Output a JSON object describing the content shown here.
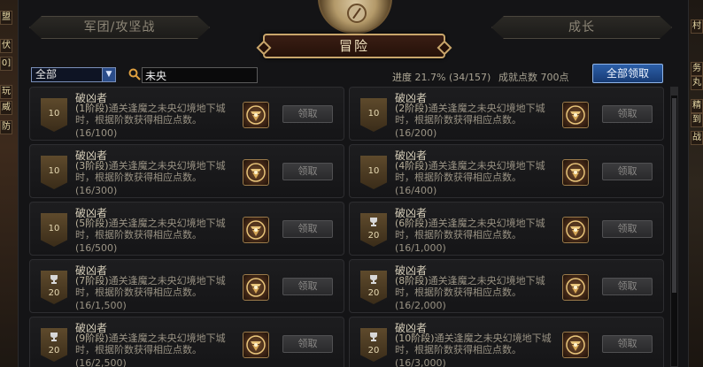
{
  "tabs": {
    "left": "军团/攻坚战",
    "main": "冒险",
    "right": "成长"
  },
  "filter": {
    "selected": "全部"
  },
  "search": {
    "value": "未央"
  },
  "progress": {
    "label": "进度",
    "percent": "21.7%",
    "fraction": "(34/157)"
  },
  "points": {
    "label": "成就点数",
    "value": "700点"
  },
  "claim_all": "全部领取",
  "left_edge_tags": [
    "盟",
    "伏妖",
    "0]",
    "玩",
    "威",
    "防守"
  ],
  "right_edge_tags": [
    "村",
    "务",
    "丸",
    "精",
    "到",
    "战"
  ],
  "achievements": [
    {
      "title": "破凶者",
      "stage": "(1阶段)",
      "desc": "通关逢魔之未央幻境地下城时，根据阶数获得相应点数。",
      "count": "(16/100)",
      "points": "10",
      "trophy": false,
      "claim": "领取"
    },
    {
      "title": "破凶者",
      "stage": "(2阶段)",
      "desc": "通关逢魔之未央幻境地下城时，根据阶数获得相应点数。",
      "count": "(16/200)",
      "points": "10",
      "trophy": false,
      "claim": "领取"
    },
    {
      "title": "破凶者",
      "stage": "(3阶段)",
      "desc": "通关逢魔之未央幻境地下城时，根据阶数获得相应点数。",
      "count": "(16/300)",
      "points": "10",
      "trophy": false,
      "claim": "领取"
    },
    {
      "title": "破凶者",
      "stage": "(4阶段)",
      "desc": "通关逢魔之未央幻境地下城时，根据阶数获得相应点数。",
      "count": "(16/400)",
      "points": "10",
      "trophy": false,
      "claim": "领取"
    },
    {
      "title": "破凶者",
      "stage": "(5阶段)",
      "desc": "通关逢魔之未央幻境地下城时，根据阶数获得相应点数。",
      "count": "(16/500)",
      "points": "10",
      "trophy": false,
      "claim": "领取"
    },
    {
      "title": "破凶者",
      "stage": "(6阶段)",
      "desc": "通关逢魔之未央幻境地下城时，根据阶数获得相应点数。",
      "count": "(16/1,000)",
      "points": "20",
      "trophy": true,
      "claim": "领取"
    },
    {
      "title": "破凶者",
      "stage": "(7阶段)",
      "desc": "通关逢魔之未央幻境地下城时，根据阶数获得相应点数。",
      "count": "(16/1,500)",
      "points": "20",
      "trophy": true,
      "claim": "领取"
    },
    {
      "title": "破凶者",
      "stage": "(8阶段)",
      "desc": "通关逢魔之未央幻境地下城时，根据阶数获得相应点数。",
      "count": "(16/2,000)",
      "points": "20",
      "trophy": true,
      "claim": "领取"
    },
    {
      "title": "破凶者",
      "stage": "(9阶段)",
      "desc": "通关逢魔之未央幻境地下城时，根据阶数获得相应点数。",
      "count": "(16/2,500)",
      "points": "20",
      "trophy": true,
      "claim": "领取"
    },
    {
      "title": "破凶者",
      "stage": "(10阶段)",
      "desc": "通关逢魔之未央幻境地下城时，根据阶数获得相应点数。",
      "count": "(16/3,000)",
      "points": "20",
      "trophy": true,
      "claim": "领取"
    }
  ]
}
